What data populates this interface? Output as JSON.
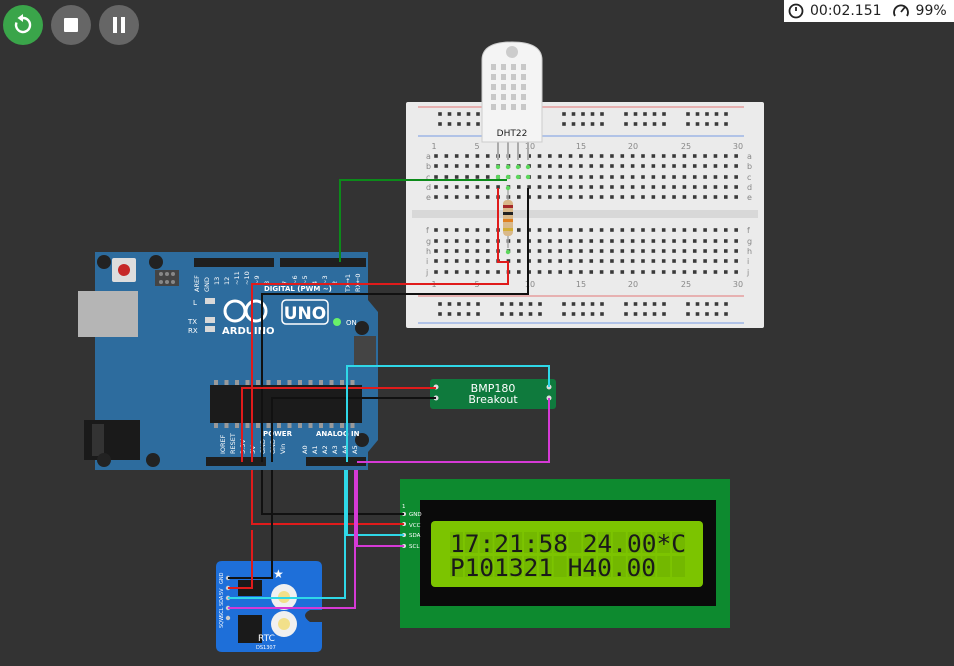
{
  "toolbar": {
    "restart_icon": "restart-icon",
    "stop_icon": "stop-icon",
    "pause_icon": "pause-icon",
    "colors": {
      "restart_bg": "#3aa54a",
      "stop_bg": "#666666",
      "pause_bg": "#666666"
    }
  },
  "status": {
    "timer": "00:02.151",
    "speed": "99%"
  },
  "dht22": {
    "label": "DHT22"
  },
  "breadboard": {
    "column_labels": [
      "1",
      "5",
      "10",
      "15",
      "20",
      "25",
      "30"
    ],
    "row_labels_top": [
      "a",
      "b",
      "c",
      "d",
      "e"
    ],
    "row_labels_bottom": [
      "f",
      "g",
      "h",
      "i",
      "j"
    ]
  },
  "arduino": {
    "brand": "ARDUINO",
    "model": "UNO",
    "on_label": "ON",
    "digital_label": "DIGITAL (PWM ~)",
    "power_label": "POWER",
    "analog_label": "ANALOG IN",
    "tx": "TX",
    "rx": "RX",
    "l": "L",
    "top_pins": [
      "AREF",
      "GND",
      "13",
      "12",
      "~11",
      "~10",
      "~9",
      "8",
      "7",
      "~6",
      "~5",
      "4",
      "~3",
      "2",
      "TX→1",
      "RX←0"
    ],
    "bottom_pins": [
      "IOREF",
      "RESET",
      "3.3V",
      "5V",
      "GND",
      "GND",
      "Vin",
      "A0",
      "A1",
      "A2",
      "A3",
      "A4",
      "A5"
    ]
  },
  "bmp180": {
    "line1": "BMP180",
    "line2": "Breakout"
  },
  "lcd": {
    "line1": "17:21:58 24.00*C",
    "line2": "P101321 H40.00",
    "pin_labels": [
      "GND",
      "VCC",
      "SDA",
      "SCL"
    ],
    "pin_number": "1"
  },
  "rtc": {
    "label": "RTC",
    "chip": "DS1307",
    "pins": [
      "GND",
      "5V",
      "SDA",
      "SCL",
      "SQW"
    ]
  }
}
